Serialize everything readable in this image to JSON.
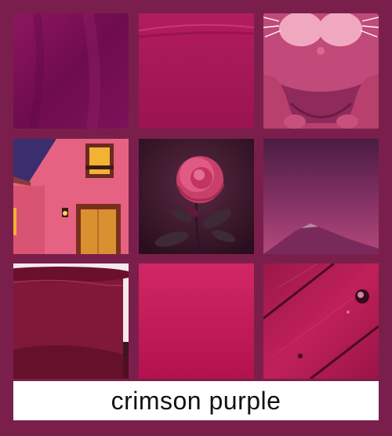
{
  "caption": "crimson purple",
  "tiles": [
    {
      "id": "fabric-drape",
      "color": "#7d1152"
    },
    {
      "id": "fabric-fold",
      "color": "#a81a55"
    },
    {
      "id": "cartoon-cat",
      "color": "#c24a75"
    },
    {
      "id": "cartoon-house",
      "color": "#e2587a"
    },
    {
      "id": "rose",
      "color": "#c83a66"
    },
    {
      "id": "mountain-haze",
      "color": "#6e2b5a"
    },
    {
      "id": "bowl",
      "color": "#7a1635"
    },
    {
      "id": "gradient",
      "color": "#c01a57"
    },
    {
      "id": "wood-plank",
      "color": "#b0194d"
    }
  ]
}
